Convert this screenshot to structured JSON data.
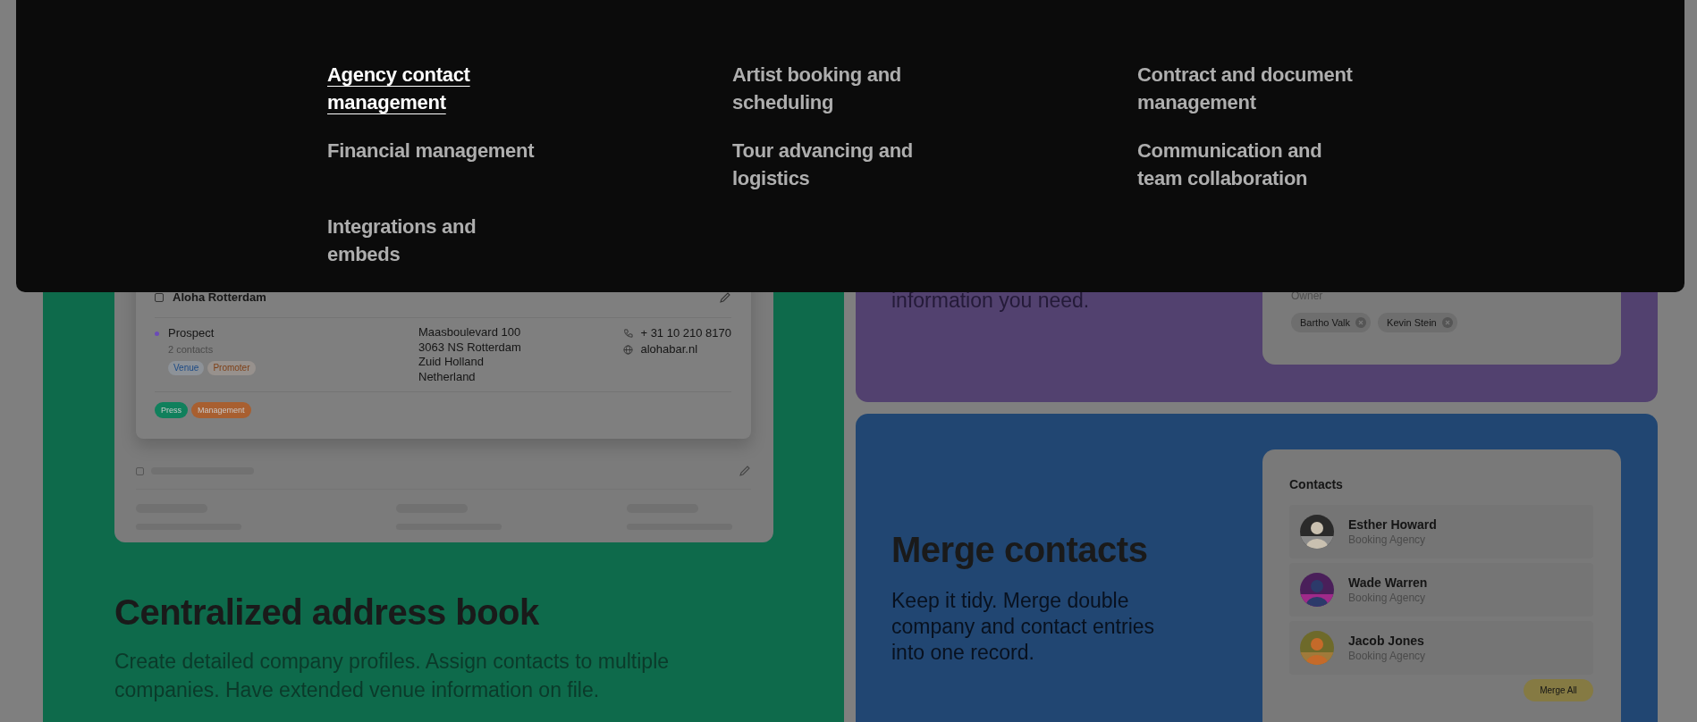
{
  "menu": {
    "items": [
      {
        "label": "Agency contact management",
        "selected": true
      },
      {
        "label": "Artist booking and scheduling",
        "selected": false
      },
      {
        "label": "Contract and document management",
        "selected": false
      },
      {
        "label": "Financial management",
        "selected": false
      },
      {
        "label": "Tour advancing and logistics",
        "selected": false
      },
      {
        "label": "Communication and team collaboration",
        "selected": false
      },
      {
        "label": "Integrations and embeds",
        "selected": false
      }
    ]
  },
  "address_book": {
    "record": {
      "checked": false,
      "company": "Aloha Rotterdam",
      "status": "Prospect",
      "contacts_count": "2 contacts",
      "tags": [
        {
          "label": "Venue",
          "color": "#1c4a85"
        },
        {
          "label": "Promoter",
          "color": "#7e3f16"
        }
      ],
      "address": [
        "Maasboulevard 100",
        "3063 NS Rotterdam",
        "Zuid Holland",
        "Netherland"
      ],
      "phone": "+ 31 10 210 8170",
      "website": "alohabar.nl",
      "groups": [
        {
          "label": "Press",
          "color": "#10805c"
        },
        {
          "label": "Management",
          "color": "#a85f30"
        }
      ]
    },
    "placeholder_row": {
      "checked": false
    },
    "title": "Centralized address book",
    "description": "Create detailed company profiles. Assign contacts to multiple companies. Have extended venue information on file."
  },
  "filter_panel": {
    "text": "information you need.",
    "owner_label": "Owner",
    "owners": [
      "Bartho Valk",
      "Kevin Stein"
    ]
  },
  "merge": {
    "title": "Merge contacts",
    "description": "Keep it tidy. Merge double company and contact entries into one record.",
    "panel_title": "Contacts",
    "contacts": [
      {
        "name": "Esther Howard",
        "company": "Booking Agency"
      },
      {
        "name": "Wade Warren",
        "company": "Booking Agency"
      },
      {
        "name": "Jacob Jones",
        "company": "Booking Agency"
      }
    ],
    "button": "Merge All"
  }
}
